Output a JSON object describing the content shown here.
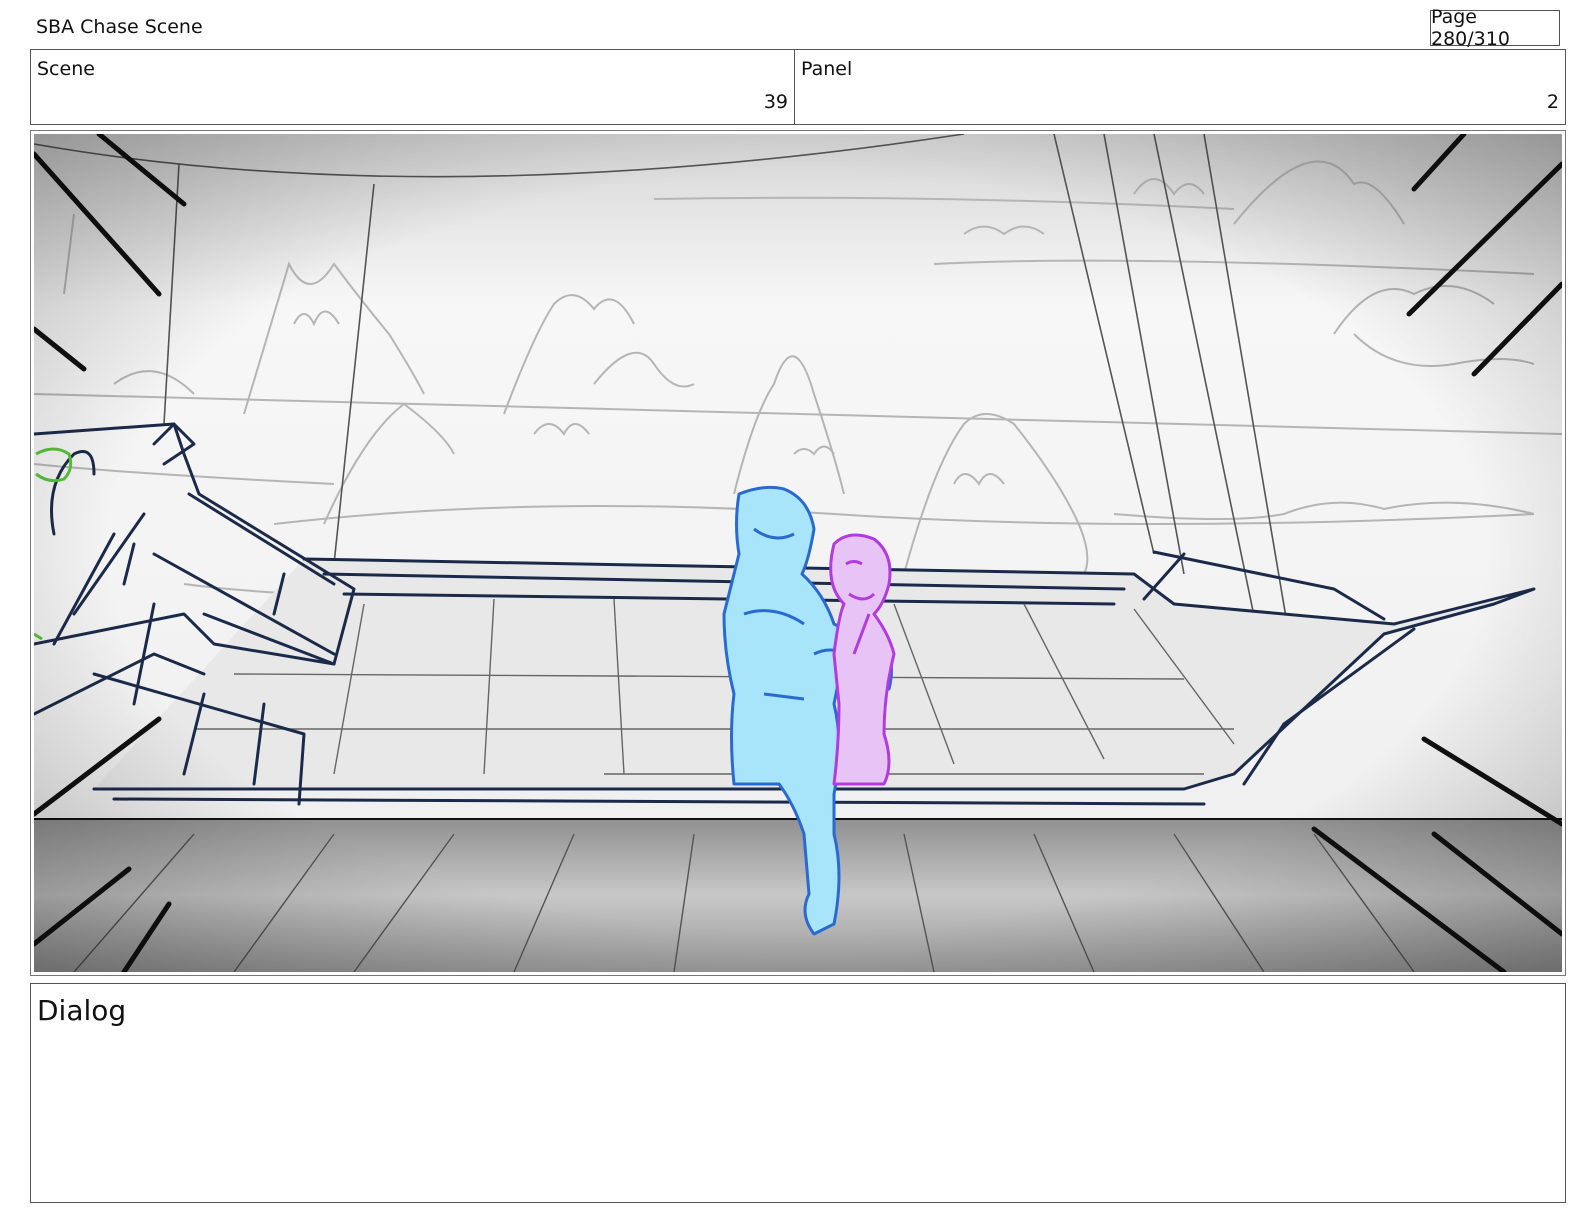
{
  "header": {
    "document_title": "SBA Chase Scene",
    "page_indicator": "Page 280/310"
  },
  "info": {
    "scene_label": "Scene",
    "scene_number": "39",
    "panel_label": "Panel",
    "panel_number": "2"
  },
  "artwork": {
    "colors": {
      "ink": "#1c2a4a",
      "character_a": "#a8e4fa",
      "character_a_line": "#2a6ad0",
      "character_b": "#e7c4f5",
      "character_b_line": "#b23be0",
      "green_prop": "#58c23c"
    }
  },
  "dialog": {
    "label": "Dialog"
  }
}
